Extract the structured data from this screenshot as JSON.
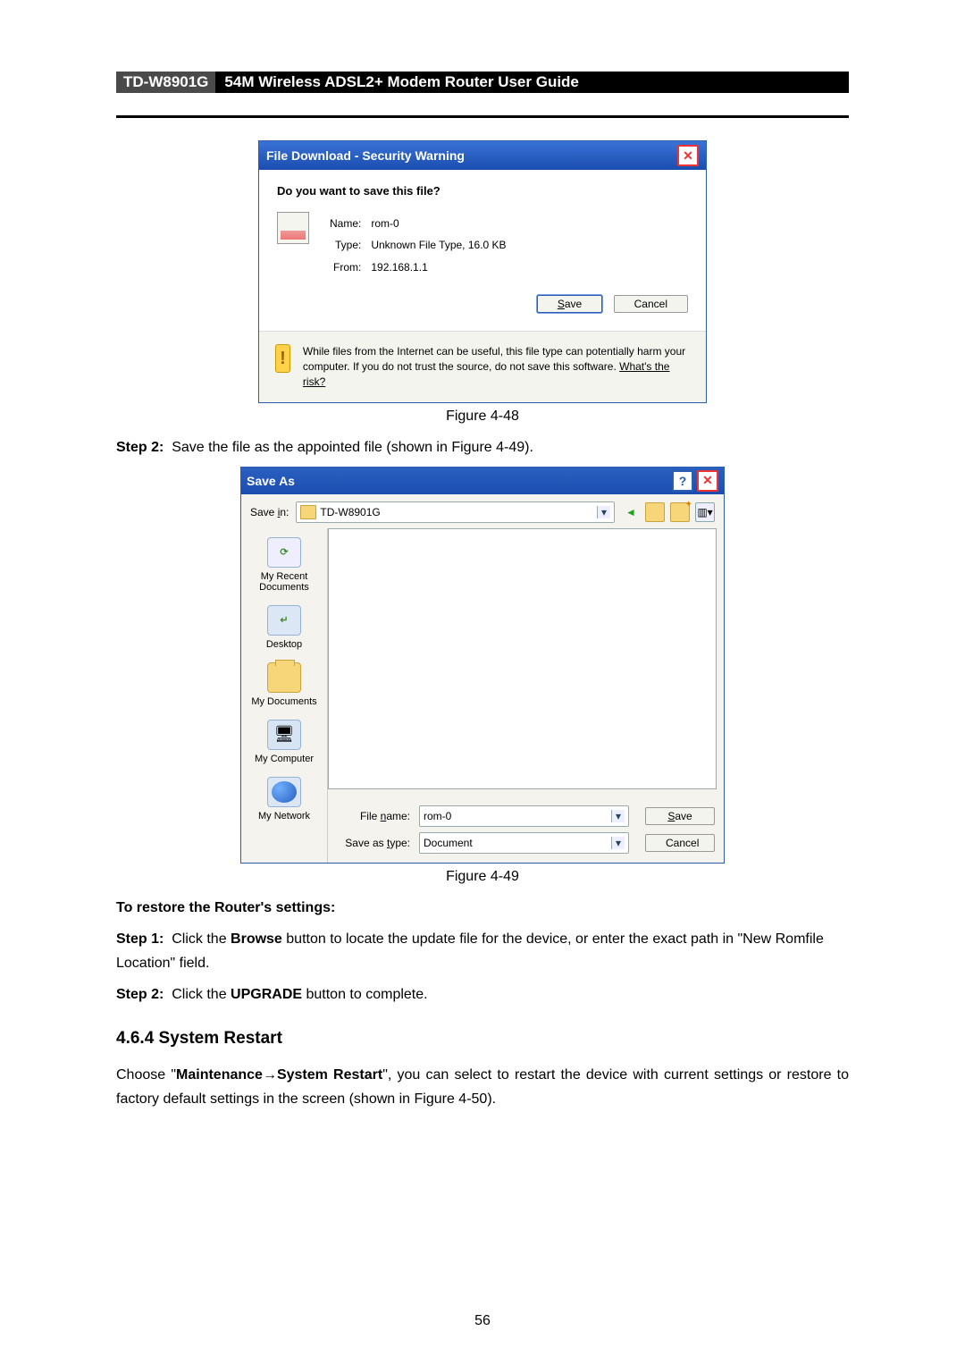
{
  "header": {
    "model": "TD-W8901G",
    "title": "54M Wireless ADSL2+ Modem Router User Guide"
  },
  "dialog1": {
    "title": "File Download - Security Warning",
    "question": "Do you want to save this file?",
    "name_label": "Name:",
    "name_value": "rom-0",
    "type_label": "Type:",
    "type_value": "Unknown File Type, 16.0 KB",
    "from_label": "From:",
    "from_value": "192.168.1.1",
    "save": "Save",
    "cancel": "Cancel",
    "warn": "While files from the Internet can be useful, this file type can potentially harm your computer. If you do not trust the source, do not save this software.",
    "risk_link": "What's the risk?"
  },
  "fig48": "Figure 4-48",
  "step2a": {
    "label": "Step 2:",
    "text": "Save the file as the appointed file (shown in Figure 4-49)."
  },
  "dialog2": {
    "title": "Save As",
    "savein_label": "Save in:",
    "savein_value": "TD-W8901G",
    "places": {
      "recent": "My Recent Documents",
      "desktop": "Desktop",
      "docs": "My Documents",
      "computer": "My Computer",
      "network": "My Network"
    },
    "filename_label": "File name:",
    "filename_value": "rom-0",
    "saveastype_label": "Save as type:",
    "saveastype_value": "Document",
    "save": "Save",
    "cancel": "Cancel"
  },
  "fig49": "Figure 4-49",
  "restore_h": "To restore the Router's settings:",
  "step1": {
    "label": "Step 1:",
    "a": "Click the ",
    "b": "Browse",
    "c": " button to locate the update file for the device, or enter the exact path in \"New Romfile Location\" field."
  },
  "step2b": {
    "label": "Step 2:",
    "a": "Click the ",
    "b": "UPGRADE",
    "c": " button to complete."
  },
  "section": {
    "num": "4.6.4 ",
    "title": "System Restart"
  },
  "para": {
    "a": "Choose \"",
    "b": "Maintenance",
    "arrow": "→",
    "c": "System Restart",
    "d": "\", you can select to restart the device with current settings or restore to factory default settings in the screen (shown in Figure 4-50)."
  },
  "page_num": "56"
}
